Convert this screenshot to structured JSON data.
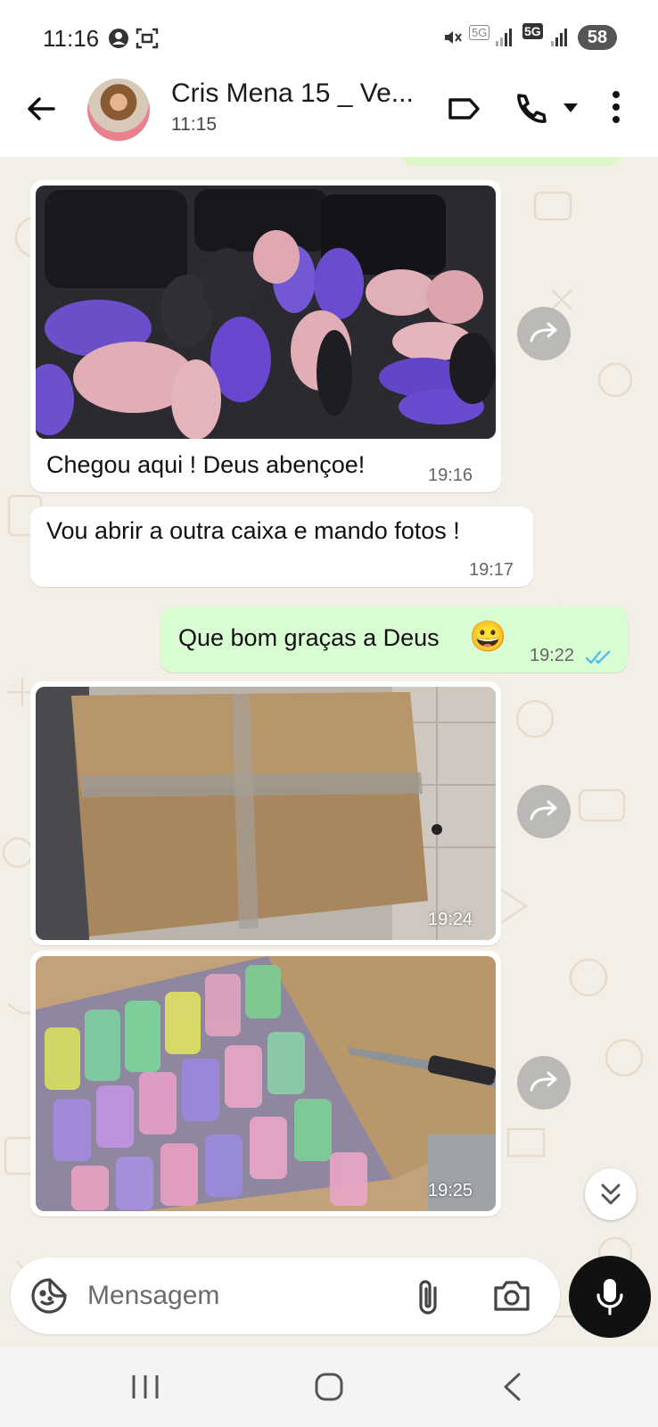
{
  "status_bar": {
    "time": "11:16",
    "network_1": "5G",
    "network_2": "5G",
    "battery": "58"
  },
  "header": {
    "contact_name": "Cris Mena 15 _ Ve...",
    "last_seen": "11:15"
  },
  "messages": [
    {
      "direction": "in",
      "type": "image",
      "description_icon": "photo-bags",
      "caption": "Chegou aqui ! Deus abençoe!",
      "time": "19:16"
    },
    {
      "direction": "in",
      "type": "text",
      "text": "Vou abrir a outra caixa e mando fotos !",
      "time": "19:17"
    },
    {
      "direction": "out",
      "type": "text",
      "text": "Que bom graças a Deus",
      "emoji": "😀",
      "time": "19:22",
      "status": "read"
    },
    {
      "direction": "in",
      "type": "image",
      "description_icon": "photo-box",
      "time": "19:24"
    },
    {
      "direction": "in",
      "type": "image",
      "description_icon": "photo-open-box",
      "time": "19:25"
    }
  ],
  "composer": {
    "placeholder": "Mensagem"
  },
  "colors": {
    "chat_background": "#f4efe6",
    "incoming_bubble": "#ffffff",
    "outgoing_bubble": "#d9fdd3",
    "read_ticks": "#53bdeb",
    "mic_button": "#111111"
  }
}
